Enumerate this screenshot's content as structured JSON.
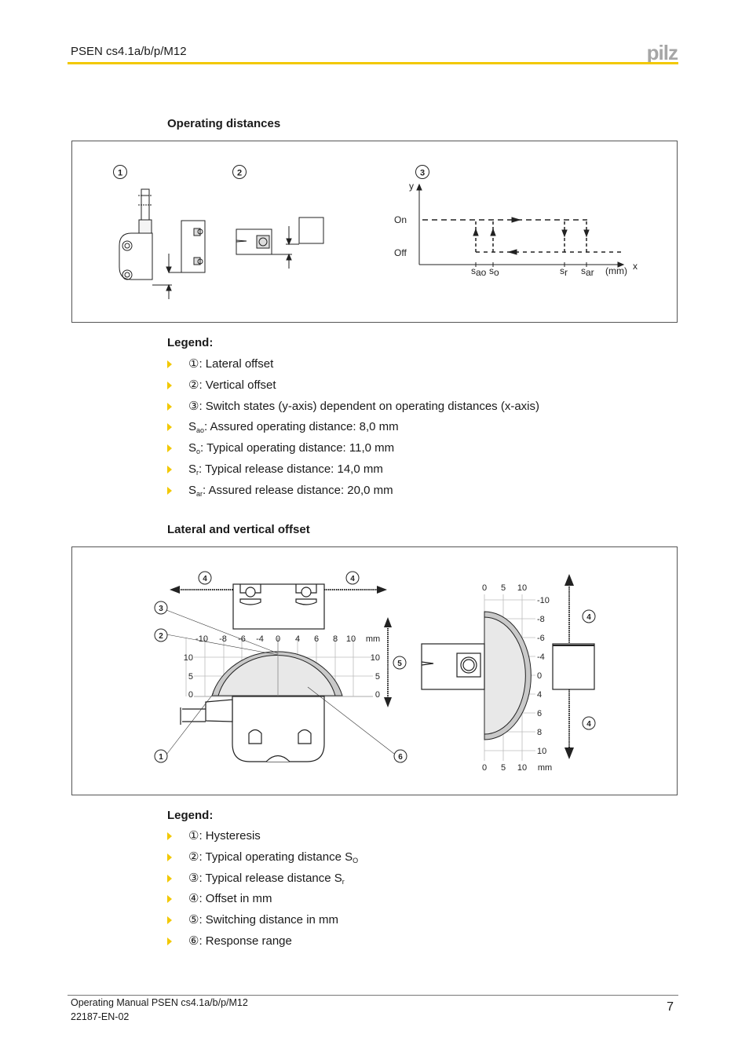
{
  "header": {
    "title": "PSEN cs4.1a/b/p/M12",
    "logo": "pilz",
    "accent_color": "#f2c800"
  },
  "section1": {
    "title": "Operating distances",
    "figure": {
      "callouts": [
        "1",
        "2",
        "3"
      ],
      "graph": {
        "y_axis": "y",
        "x_axis": "x",
        "x_unit": "(mm)",
        "states": [
          "On",
          "Off"
        ],
        "markers": [
          "s",
          "s",
          "s",
          "s"
        ],
        "marker_subs": [
          "ao",
          "o",
          "r",
          "ar"
        ]
      }
    },
    "legend_title": "Legend:",
    "legend": [
      {
        "prefix": "①",
        "text": ": Lateral offset"
      },
      {
        "prefix": "②",
        "text": ": Vertical offset"
      },
      {
        "prefix": "③",
        "text": ": Switch states (y-axis) dependent on operating distances (x-axis)"
      },
      {
        "prefix": "S",
        "sub": "ao",
        "text": ": Assured operating distance: 8,0 mm"
      },
      {
        "prefix": "S",
        "sub": "o",
        "text": ": Typical operating distance: 11,0 mm"
      },
      {
        "prefix": "S",
        "sub": "r",
        "text": ": Typical release distance: 14,0 mm"
      },
      {
        "prefix": "S",
        "sub": "ar",
        "text": ": Assured release distance: 20,0 mm"
      }
    ]
  },
  "section2": {
    "title": "Lateral and vertical offset",
    "figure": {
      "left_x_ticks": [
        "-10",
        "-8",
        "-6",
        "-4",
        "0",
        "4",
        "6",
        "8",
        "10",
        "mm"
      ],
      "left_y_ticks": [
        "10",
        "5",
        "0"
      ],
      "right_x_ticks_top": [
        "0",
        "5",
        "10"
      ],
      "right_x_ticks_bottom": [
        "0",
        "5",
        "10",
        "mm"
      ],
      "right_y_ticks": [
        "-10",
        "-8",
        "-6",
        "-4",
        "0",
        "4",
        "6",
        "8",
        "10"
      ],
      "callouts": [
        "1",
        "2",
        "3",
        "4",
        "5",
        "6"
      ]
    },
    "legend_title": "Legend:",
    "legend": [
      {
        "prefix": "①",
        "text": ": Hysteresis"
      },
      {
        "prefix": "②",
        "text": ": Typical operating distance S",
        "sub": "O"
      },
      {
        "prefix": "③",
        "text": ": Typical release distance S",
        "sub": "r"
      },
      {
        "prefix": "④",
        "text": ": Offset in mm"
      },
      {
        "prefix": "⑤",
        "text": ": Switching distance in mm"
      },
      {
        "prefix": "⑥",
        "text": ": Response range"
      }
    ]
  },
  "footer": {
    "line1": "Operating Manual PSEN cs4.1a/b/p/M12",
    "line2": "22187-EN-02",
    "page_number": "7"
  }
}
